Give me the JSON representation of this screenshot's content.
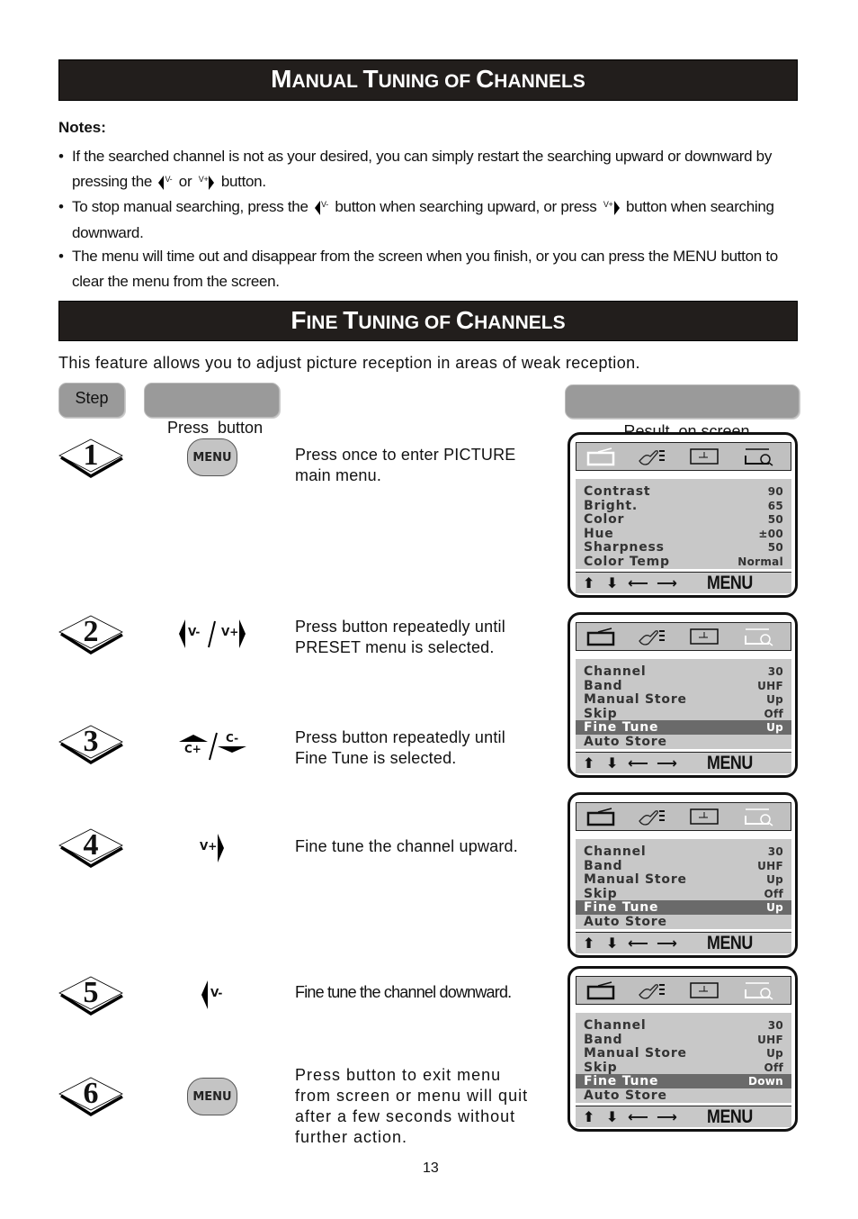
{
  "manual_section": {
    "title_caps": [
      "M",
      "ANUAL ",
      "T",
      "UNING OF ",
      "C",
      "HANNELS"
    ],
    "notes_title": "Notes:",
    "notes": [
      {
        "parts": [
          "If the searched channel is not as your desired, you can simply restart the searching upward or downward by pressing the",
          "or",
          "button."
        ],
        "keys": [
          "V-",
          "V+"
        ]
      },
      {
        "parts": [
          "To stop manual searching, press the",
          "button when searching upward, or press",
          "button when searching downward."
        ],
        "keys": [
          "V-",
          "V+"
        ]
      },
      {
        "text": "The menu will time out and disappear from the screen when you finish, or you can press the MENU button to clear the menu from the screen."
      }
    ],
    "bullet": "•"
  },
  "fine_section": {
    "title_caps": [
      "F",
      "INE ",
      "T",
      "UNING OF ",
      "C",
      "HANNELS"
    ],
    "intro": "This feature allows you to adjust picture reception in areas of weak reception.",
    "headers": {
      "step": "Step",
      "press": "Press  button",
      "result": "Result  on screen"
    }
  },
  "steps": [
    {
      "number": "1",
      "button": {
        "type": "menu",
        "label": "MENU"
      },
      "text": [
        "Press once to enter PICTURE",
        "main menu."
      ]
    },
    {
      "number": "2",
      "button": {
        "type": "v-pair",
        "left": "V-",
        "right": "V+"
      },
      "text": [
        "Press button repeatedly until",
        "PRESET menu is selected."
      ]
    },
    {
      "number": "3",
      "button": {
        "type": "c-pair",
        "left": "C+",
        "right": "C-"
      },
      "text": [
        "Press button repeatedly until",
        "Fine Tune is selected."
      ]
    },
    {
      "number": "4",
      "button": {
        "type": "v-plus",
        "label": "V+"
      },
      "text": [
        "Fine tune the channel upward."
      ]
    },
    {
      "number": "5",
      "button": {
        "type": "v-minus",
        "label": "V-"
      },
      "text": [
        "Fine tune the channel downward."
      ]
    },
    {
      "number": "6",
      "button": {
        "type": "menu",
        "label": "MENU"
      },
      "text": [
        "Press button to exit menu",
        "from screen or menu will quit",
        "after a few seconds without",
        "further action."
      ]
    }
  ],
  "screens": [
    {
      "active_tab": "picture",
      "rows": [
        {
          "label": "Contrast",
          "value": "90"
        },
        {
          "label": "Bright.",
          "value": "65"
        },
        {
          "label": "Color",
          "value": "50"
        },
        {
          "label": "Hue",
          "value": "±00"
        },
        {
          "label": "Sharpness",
          "value": "50"
        },
        {
          "label": "Color Temp",
          "value": "Normal"
        }
      ],
      "selected_row": null,
      "footer": {
        "arrows": [
          "⬆",
          "⬇",
          "⟵",
          "⟶"
        ],
        "menu_label": "MENU"
      }
    },
    {
      "active_tab": "preset",
      "rows": [
        {
          "label": "Channel",
          "value": "30"
        },
        {
          "label": "Band",
          "value": "UHF"
        },
        {
          "label": "Manual Store",
          "value": "Up"
        },
        {
          "label": "Skip",
          "value": "Off"
        },
        {
          "label": "Fine Tune",
          "value": "Up"
        },
        {
          "label": "Auto Store",
          "value": ""
        }
      ],
      "selected_row": 4,
      "footer": {
        "arrows": [
          "⬆",
          "⬇",
          "⟵",
          "⟶"
        ],
        "menu_label": "MENU"
      }
    },
    {
      "active_tab": "preset",
      "rows": [
        {
          "label": "Channel",
          "value": "30"
        },
        {
          "label": "Band",
          "value": "UHF"
        },
        {
          "label": "Manual Store",
          "value": "Up"
        },
        {
          "label": "Skip",
          "value": "Off"
        },
        {
          "label": "Fine Tune",
          "value": "Up"
        },
        {
          "label": "Auto Store",
          "value": ""
        }
      ],
      "selected_row": 4,
      "footer": {
        "arrows": [
          "⬆",
          "⬇",
          "⟵",
          "⟶"
        ],
        "menu_label": "MENU"
      }
    },
    {
      "active_tab": "preset",
      "rows": [
        {
          "label": "Channel",
          "value": "30"
        },
        {
          "label": "Band",
          "value": "UHF"
        },
        {
          "label": "Manual Store",
          "value": "Up"
        },
        {
          "label": "Skip",
          "value": "Off"
        },
        {
          "label": "Fine Tune",
          "value": "Down"
        },
        {
          "label": "Auto Store",
          "value": ""
        }
      ],
      "selected_row": 4,
      "footer": {
        "arrows": [
          "⬆",
          "⬇",
          "⟵",
          "⟶"
        ],
        "menu_label": "MENU"
      }
    }
  ],
  "tab_icons": [
    "tv-icon",
    "hand-settings-icon",
    "clock-icon",
    "search-screen-icon"
  ],
  "page_number": "13",
  "colors": {
    "banner_bg": "#221e1c",
    "pill_bg": "#9a9a9a",
    "osd_bg": "#c8c8c8",
    "osd_selected": "#6a6a6a",
    "button_bg": "#c4c4c4"
  }
}
